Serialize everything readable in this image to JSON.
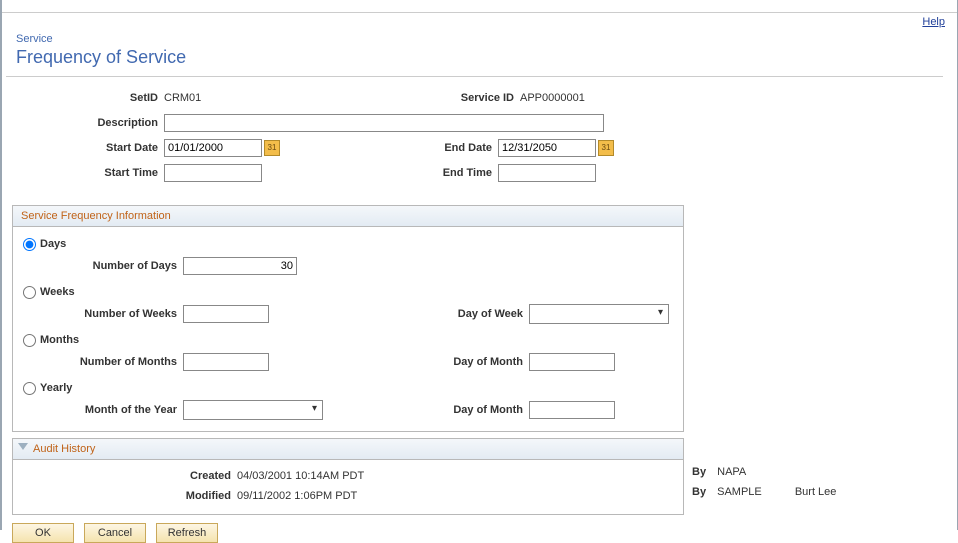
{
  "help_label": "Help",
  "breadcrumb": "Service",
  "page_title": "Frequency of Service",
  "form": {
    "setid_label": "SetID",
    "setid_value": "CRM01",
    "serviceid_label": "Service ID",
    "serviceid_value": "APP0000001",
    "description_label": "Description",
    "description_value": "",
    "start_date_label": "Start Date",
    "start_date_value": "01/01/2000",
    "end_date_label": "End Date",
    "end_date_value": "12/31/2050",
    "start_time_label": "Start Time",
    "start_time_value": "",
    "end_time_label": "End Time",
    "end_time_value": ""
  },
  "freq": {
    "heading": "Service Frequency Information",
    "days_label": "Days",
    "num_days_label": "Number of Days",
    "num_days_value": "30",
    "weeks_label": "Weeks",
    "num_weeks_label": "Number of Weeks",
    "num_weeks_value": "",
    "day_of_week_label": "Day of Week",
    "day_of_week_value": "",
    "months_label": "Months",
    "num_months_label": "Number of Months",
    "num_months_value": "",
    "day_of_month_label": "Day of Month",
    "day_of_month_value": "",
    "yearly_label": "Yearly",
    "month_of_year_label": "Month of the Year",
    "month_of_year_value": "",
    "day_of_month2_label": "Day of Month",
    "day_of_month2_value": ""
  },
  "audit": {
    "heading": "Audit History",
    "created_label": "Created",
    "created_value": "04/03/2001 10:14AM PDT",
    "modified_label": "Modified",
    "modified_value": "09/11/2002  1:06PM PDT",
    "by_label": "By",
    "created_by_id": "NAPA",
    "created_by_name": "",
    "modified_by_id": "SAMPLE",
    "modified_by_name": "Burt Lee"
  },
  "buttons": {
    "ok": "OK",
    "cancel": "Cancel",
    "refresh": "Refresh"
  }
}
